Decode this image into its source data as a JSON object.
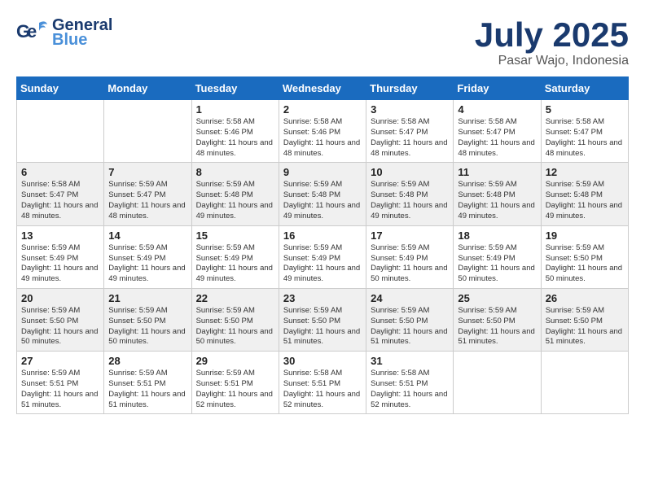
{
  "header": {
    "logo_general": "General",
    "logo_blue": "Blue",
    "month_title": "July 2025",
    "subtitle": "Pasar Wajo, Indonesia"
  },
  "weekdays": [
    "Sunday",
    "Monday",
    "Tuesday",
    "Wednesday",
    "Thursday",
    "Friday",
    "Saturday"
  ],
  "weeks": [
    [
      {
        "day": "",
        "info": ""
      },
      {
        "day": "",
        "info": ""
      },
      {
        "day": "1",
        "info": "Sunrise: 5:58 AM\nSunset: 5:46 PM\nDaylight: 11 hours and 48 minutes."
      },
      {
        "day": "2",
        "info": "Sunrise: 5:58 AM\nSunset: 5:46 PM\nDaylight: 11 hours and 48 minutes."
      },
      {
        "day": "3",
        "info": "Sunrise: 5:58 AM\nSunset: 5:47 PM\nDaylight: 11 hours and 48 minutes."
      },
      {
        "day": "4",
        "info": "Sunrise: 5:58 AM\nSunset: 5:47 PM\nDaylight: 11 hours and 48 minutes."
      },
      {
        "day": "5",
        "info": "Sunrise: 5:58 AM\nSunset: 5:47 PM\nDaylight: 11 hours and 48 minutes."
      }
    ],
    [
      {
        "day": "6",
        "info": "Sunrise: 5:58 AM\nSunset: 5:47 PM\nDaylight: 11 hours and 48 minutes."
      },
      {
        "day": "7",
        "info": "Sunrise: 5:59 AM\nSunset: 5:47 PM\nDaylight: 11 hours and 48 minutes."
      },
      {
        "day": "8",
        "info": "Sunrise: 5:59 AM\nSunset: 5:48 PM\nDaylight: 11 hours and 49 minutes."
      },
      {
        "day": "9",
        "info": "Sunrise: 5:59 AM\nSunset: 5:48 PM\nDaylight: 11 hours and 49 minutes."
      },
      {
        "day": "10",
        "info": "Sunrise: 5:59 AM\nSunset: 5:48 PM\nDaylight: 11 hours and 49 minutes."
      },
      {
        "day": "11",
        "info": "Sunrise: 5:59 AM\nSunset: 5:48 PM\nDaylight: 11 hours and 49 minutes."
      },
      {
        "day": "12",
        "info": "Sunrise: 5:59 AM\nSunset: 5:48 PM\nDaylight: 11 hours and 49 minutes."
      }
    ],
    [
      {
        "day": "13",
        "info": "Sunrise: 5:59 AM\nSunset: 5:49 PM\nDaylight: 11 hours and 49 minutes."
      },
      {
        "day": "14",
        "info": "Sunrise: 5:59 AM\nSunset: 5:49 PM\nDaylight: 11 hours and 49 minutes."
      },
      {
        "day": "15",
        "info": "Sunrise: 5:59 AM\nSunset: 5:49 PM\nDaylight: 11 hours and 49 minutes."
      },
      {
        "day": "16",
        "info": "Sunrise: 5:59 AM\nSunset: 5:49 PM\nDaylight: 11 hours and 49 minutes."
      },
      {
        "day": "17",
        "info": "Sunrise: 5:59 AM\nSunset: 5:49 PM\nDaylight: 11 hours and 50 minutes."
      },
      {
        "day": "18",
        "info": "Sunrise: 5:59 AM\nSunset: 5:49 PM\nDaylight: 11 hours and 50 minutes."
      },
      {
        "day": "19",
        "info": "Sunrise: 5:59 AM\nSunset: 5:50 PM\nDaylight: 11 hours and 50 minutes."
      }
    ],
    [
      {
        "day": "20",
        "info": "Sunrise: 5:59 AM\nSunset: 5:50 PM\nDaylight: 11 hours and 50 minutes."
      },
      {
        "day": "21",
        "info": "Sunrise: 5:59 AM\nSunset: 5:50 PM\nDaylight: 11 hours and 50 minutes."
      },
      {
        "day": "22",
        "info": "Sunrise: 5:59 AM\nSunset: 5:50 PM\nDaylight: 11 hours and 50 minutes."
      },
      {
        "day": "23",
        "info": "Sunrise: 5:59 AM\nSunset: 5:50 PM\nDaylight: 11 hours and 51 minutes."
      },
      {
        "day": "24",
        "info": "Sunrise: 5:59 AM\nSunset: 5:50 PM\nDaylight: 11 hours and 51 minutes."
      },
      {
        "day": "25",
        "info": "Sunrise: 5:59 AM\nSunset: 5:50 PM\nDaylight: 11 hours and 51 minutes."
      },
      {
        "day": "26",
        "info": "Sunrise: 5:59 AM\nSunset: 5:50 PM\nDaylight: 11 hours and 51 minutes."
      }
    ],
    [
      {
        "day": "27",
        "info": "Sunrise: 5:59 AM\nSunset: 5:51 PM\nDaylight: 11 hours and 51 minutes."
      },
      {
        "day": "28",
        "info": "Sunrise: 5:59 AM\nSunset: 5:51 PM\nDaylight: 11 hours and 51 minutes."
      },
      {
        "day": "29",
        "info": "Sunrise: 5:59 AM\nSunset: 5:51 PM\nDaylight: 11 hours and 52 minutes."
      },
      {
        "day": "30",
        "info": "Sunrise: 5:58 AM\nSunset: 5:51 PM\nDaylight: 11 hours and 52 minutes."
      },
      {
        "day": "31",
        "info": "Sunrise: 5:58 AM\nSunset: 5:51 PM\nDaylight: 11 hours and 52 minutes."
      },
      {
        "day": "",
        "info": ""
      },
      {
        "day": "",
        "info": ""
      }
    ]
  ]
}
